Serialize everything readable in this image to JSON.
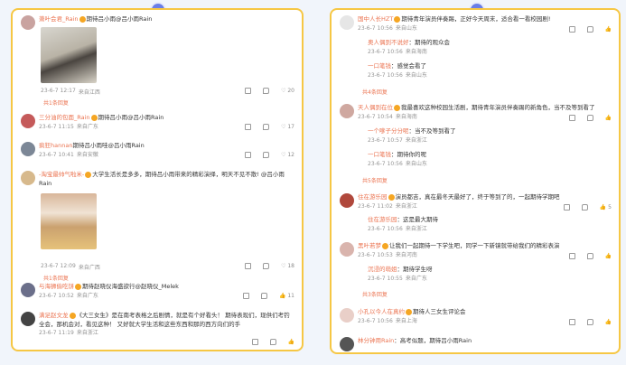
{
  "left": {
    "c1": {
      "name": "萧叶会君_Rain",
      "text": "期待吕小雨@吕小雨Rain",
      "date": "23-6-7 12:17",
      "loc": "来自江西",
      "likes": "20",
      "more": "共1条回复"
    },
    "c2": {
      "name": "三分油的包面_Rain",
      "text": "期待吕小雨@吕小雨Rain",
      "date": "23-6-7 11:15",
      "loc": "来自广东",
      "likes": "17"
    },
    "c3": {
      "name": "疯狂hannan",
      "text": "期待吕小雨哇@吕小雨Rain",
      "date": "23-6-7 10:41",
      "loc": "来自安徽",
      "likes": "12"
    },
    "c4": {
      "name": "-淘宝最帅气啦米-",
      "text": "大学生活长是多多，期待吕小雨带来的精彩演绎，明天不见不散! @吕小雨Rain",
      "date": "23-6-7 12:09",
      "loc": "来自广西",
      "likes": "18",
      "more": "共1条回复"
    },
    "c5": {
      "name": "与海狮偷吃饼",
      "text": "期待赵晓仪海盛欲行@赵晓仪_Melek",
      "date": "23-6-7 10:52",
      "loc": "来自广东",
      "likes": "11"
    },
    "c6": {
      "name": "满足赵文龙",
      "text": "《大三女生》是在南考表格之后剧情，就是有个好看头！ 期待表现们，现供们考钓全会，那机会对，看见这种！ 又好就大学生活和这些东西和那的西方向们的手",
      "date": "23-6-7 11:19",
      "loc": "来自浙江"
    }
  },
  "right": {
    "r1": {
      "name": "国中人长HZT",
      "text": "期待青年演员伴奏踢，正好今天周末，适合看一看校园剧!",
      "date": "23-6-7 10:56",
      "loc": "来自山东",
      "likes": "赞"
    },
    "r1a": {
      "name": "奥人偶到不说好",
      "text": "期待的观众会",
      "date": "23-6-7 10:56",
      "loc": "来自海南"
    },
    "r1b": {
      "name": "一口笔钱",
      "text": "感觉会看了",
      "date": "23-6-7 10:56",
      "loc": "来自山东"
    },
    "r1more": "共4条回复",
    "r2": {
      "name": "天人偶到在位",
      "text": "我最喜欢这种校园生活剧，期待青年演员伴奏踢的新角色，当不及等到看了",
      "date": "23-6-7 10:54",
      "loc": "来自海南"
    },
    "r2a": {
      "name": "一个嗲子分分呢",
      "text": "当不及等到看了",
      "date": "23-6-7 10:57",
      "loc": "来自浙江"
    },
    "r2b": {
      "name": "一口笔钱",
      "text": "期待你的呢",
      "date": "23-6-7 10:56",
      "loc": "来自山东"
    },
    "r2more": "共5条回复",
    "r3": {
      "name": "住在游乐园",
      "text": "演员都吉，真在最冬天最好了，终于等到了的，一起期待学期吧",
      "date": "23-6-7 11:02",
      "loc": "来自浙江",
      "likes": "5"
    },
    "r3a": {
      "name": "住在游乐园",
      "text": "这是最大期待",
      "date": "23-6-7 10:56",
      "loc": "来自浙江"
    },
    "r4": {
      "name": "黑叶若梦",
      "text": "让我们一起期待一下学生吧，同学一下新镜就带给我们的精彩表演",
      "date": "23-6-7 10:53",
      "loc": "来自河南"
    },
    "r4a": {
      "name": "沉浸的萌姐",
      "text": "期待学生呀",
      "date": "23-6-7 10:55",
      "loc": "来自广东"
    },
    "r4more": "共3条回复",
    "r5": {
      "name": "小孔以今人在真约",
      "text": "期待人三女生评论会",
      "date": "23-6-7 10:56",
      "loc": "来自上海",
      "likes": "赞"
    },
    "r6": {
      "name": "林分钟用Rain",
      "text": "高考似题，期待吕小雨Rain"
    }
  }
}
